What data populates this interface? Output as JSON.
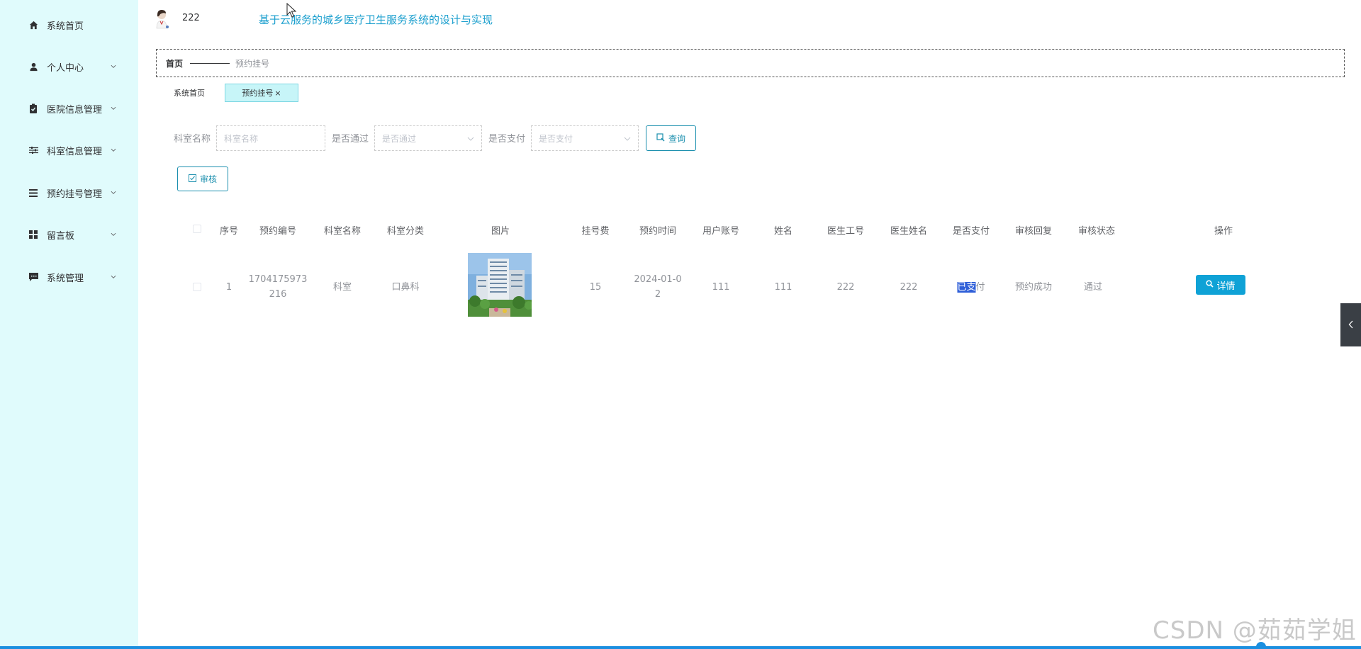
{
  "sidebar": {
    "items": [
      {
        "label": "系统首页",
        "icon": "home-icon"
      },
      {
        "label": "个人中心",
        "icon": "user-icon"
      },
      {
        "label": "医院信息管理",
        "icon": "clipboard-icon"
      },
      {
        "label": "科室信息管理",
        "icon": "sliders-icon"
      },
      {
        "label": "预约挂号管理",
        "icon": "list-icon"
      },
      {
        "label": "留言板",
        "icon": "grid-icon"
      },
      {
        "label": "系统管理",
        "icon": "message-icon"
      }
    ]
  },
  "header": {
    "username": "222",
    "app_title": "基于云服务的城乡医疗卫生服务系统的设计与实现"
  },
  "breadcrumb": {
    "home": "首页",
    "current": "预约挂号"
  },
  "tabs": [
    {
      "label": "系统首页",
      "active": false
    },
    {
      "label": "预约挂号",
      "close": "×",
      "active": true
    }
  ],
  "search": {
    "dept_name_label": "科室名称",
    "dept_name_placeholder": "科室名称",
    "passed_label": "是否通过",
    "passed_placeholder": "是否通过",
    "paid_label": "是否支付",
    "paid_placeholder": "是否支付",
    "query_button": "查询"
  },
  "actions": {
    "review_button": "审核"
  },
  "table": {
    "columns": [
      "序号",
      "预约编号",
      "科室名称",
      "科室分类",
      "图片",
      "挂号费",
      "预约时间",
      "用户账号",
      "姓名",
      "医生工号",
      "医生姓名",
      "是否支付",
      "审核回复",
      "审核状态",
      "操作"
    ],
    "rows": [
      {
        "index": "1",
        "booking_no_line1": "1704175973",
        "booking_no_line2": "216",
        "dept_name": "科室",
        "dept_category": "口鼻科",
        "fee": "15",
        "time_line1": "2024-01-0",
        "time_line2": "2",
        "user_account": "111",
        "name": "111",
        "doctor_no": "222",
        "doctor_name": "222",
        "paid_selected": "已支",
        "paid_rest": "付",
        "review_reply": "预约成功",
        "review_status": "通过",
        "detail_button": "详情"
      }
    ]
  },
  "watermark": "CSDN @茹茹学姐",
  "colors": {
    "sidebar_bg": "#e0fbfc",
    "accent": "#1b9fce",
    "detail_button": "#0fa2d6",
    "bottom_bar": "#1b8fe0"
  }
}
